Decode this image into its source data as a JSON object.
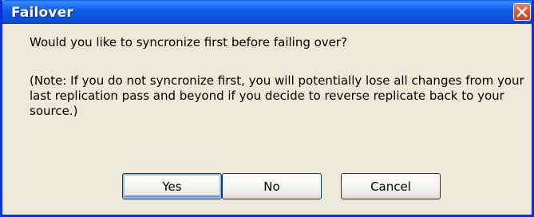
{
  "dialog": {
    "title": "Failover",
    "message": "Would you like to syncronize first before failing over?",
    "note": "(Note: If you do not syncronize first, you will potentially lose all changes from your last replication pass and beyond if you decide to reverse replicate back to your source.)",
    "buttons": {
      "yes": "Yes",
      "no": "No",
      "cancel": "Cancel"
    }
  },
  "icons": {
    "close": "close-icon"
  },
  "colors": {
    "titlebar": "#0a53df",
    "window_border": "#0831d9",
    "window_background": "#ece9d8",
    "close_button": "#d8542f",
    "button_border": "#003c74"
  }
}
